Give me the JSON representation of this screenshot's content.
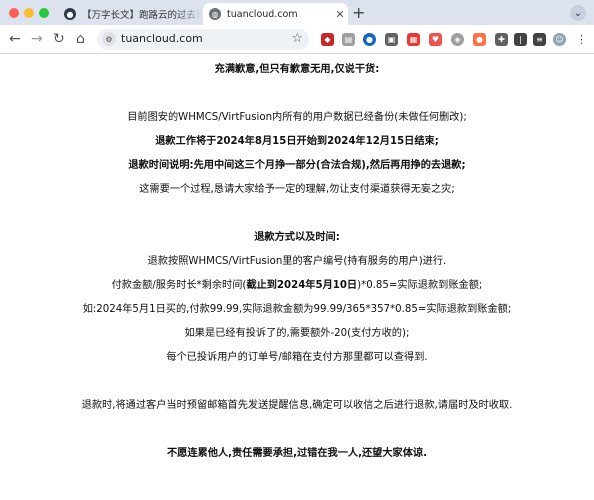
{
  "browser": {
    "tabs": [
      {
        "title": "【万字长文】跑路云的过去现在",
        "active": false
      },
      {
        "title": "tuancloud.com",
        "active": true
      }
    ],
    "new_tab_label": "+",
    "tabs_menu_icon": "chevron-down-icon",
    "address": "tuancloud.com",
    "accent": "#dce3ef"
  },
  "notice": {
    "heading": "充满歉意,但只有歉意无用,仅说干货:",
    "backup": "目前图安的WHMCS/VirtFusion内所有的用户数据已经备份(未做任何删改);",
    "period": "退款工作将于2024年8月15日开始到2024年12月15日结束;",
    "advice": "退款时间说明:先用中间这三个月挣一部分(合法合规),然后再用挣的去退款;",
    "patience": "这需要一个过程,恳请大家给予一定的理解,勿让支付渠道获得无妄之灾;",
    "method_title": "退款方式以及时间:",
    "method_basis": "退款按照WHMCS/VirtFusion里的客户编号(持有服务的用户)进行.",
    "formula_prefix": "付款金额/服务时长*剩余时间(",
    "formula_bold": "截止到2024年5月10日",
    "formula_suffix": ")*0.85=实际退款到账金额;",
    "example": "如:2024年5月1日买的,付款99.99,实际退款金额为99.99/365*357*0.85=实际退款到账金额;",
    "complaint_fee": "如果是已经有投诉了的,需要额外-20(支付方收的);",
    "complaint_check": "每个已投诉用户的订单号/邮箱在支付方那里都可以查得到.",
    "email_notice": "退款时,将通过客户当时预留邮箱首先发送提醒信息,确定可以收信之后进行退款,请届时及时收取.",
    "closing": "不愿连累他人,责任需要承担,过错在我一人,还望大家体谅."
  }
}
